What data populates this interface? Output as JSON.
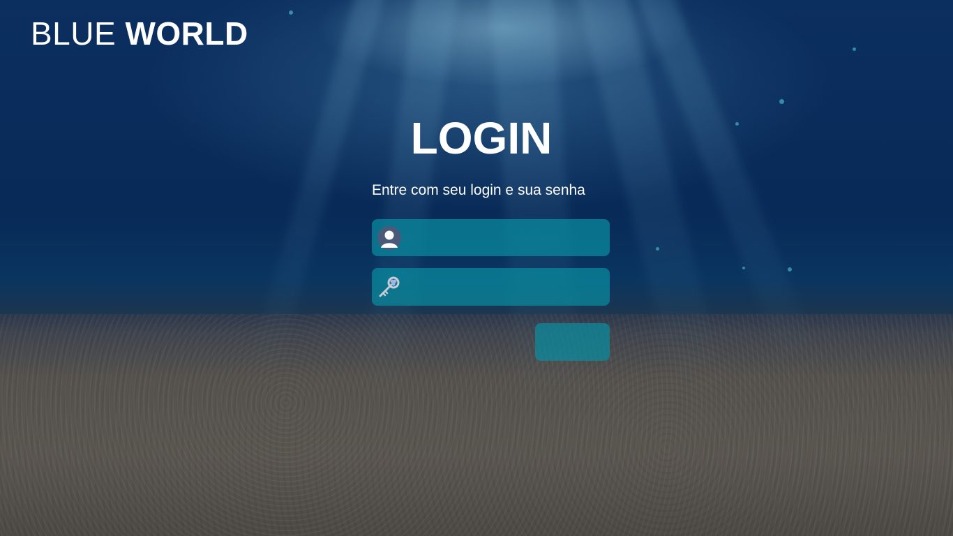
{
  "brand": {
    "light": "BLUE",
    "bold": "WORLD"
  },
  "login": {
    "title": "LOGIN",
    "subtitle": "Entre com seu login e sua senha",
    "username": {
      "value": "",
      "placeholder": "",
      "icon": "user-avatar-icon"
    },
    "password": {
      "value": "",
      "placeholder": "",
      "icon": "key-icon"
    },
    "submit_label": ""
  },
  "colors": {
    "field_background": "#0a8ca0",
    "text": "#ffffff",
    "water_top": "#0b2f5f",
    "sand": "#5a5550"
  }
}
